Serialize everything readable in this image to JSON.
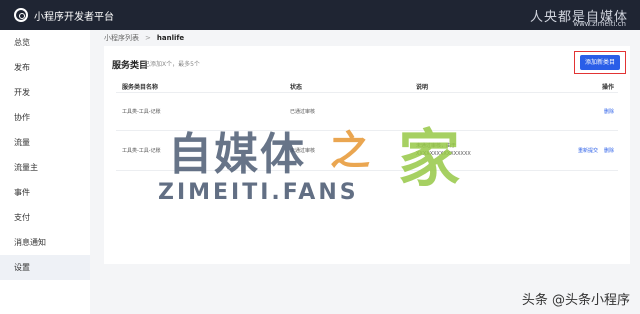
{
  "topbar": {
    "title": "小程序开发者平台",
    "right_overlay": "人央都是自媒体",
    "right_url": "www.zimeiti.cn"
  },
  "sidebar": {
    "items": [
      {
        "label": "总览"
      },
      {
        "label": "发布"
      },
      {
        "label": "开发"
      },
      {
        "label": "协作"
      },
      {
        "label": "流量"
      },
      {
        "label": "流量主"
      },
      {
        "label": "事件"
      },
      {
        "label": "支付"
      },
      {
        "label": "消息通知"
      },
      {
        "label": "设置"
      }
    ],
    "active_index": 9
  },
  "breadcrumb": {
    "parent": "小程序列表",
    "separator": ">",
    "current": "hanlife"
  },
  "panel": {
    "title": "服务类目",
    "subtitle": "已添加X个，最多5个",
    "add_button": "添加新类目",
    "columns": [
      "服务类目名称",
      "状态",
      "说明",
      "操作"
    ],
    "rows": [
      {
        "name": "工具类-工具-记账",
        "status": "已通过审核",
        "note": "",
        "actions": [
          "删除"
        ]
      },
      {
        "name": "工具类-工具-记账",
        "status": "未通过审核",
        "note": "未通过审核，由于XXXXXXXXXXXXXXXX",
        "actions": [
          "重新提交",
          "删除"
        ]
      }
    ]
  },
  "watermark": {
    "zh": "自媒体",
    "zhi": "之",
    "jia": "家",
    "en": "ZIMEITI.FANS",
    "credit": "头条 @头条小程序"
  },
  "colors": {
    "topbar_bg": "#1f2533",
    "accent_blue": "#2a5ee8",
    "highlight_red": "#e23434"
  }
}
